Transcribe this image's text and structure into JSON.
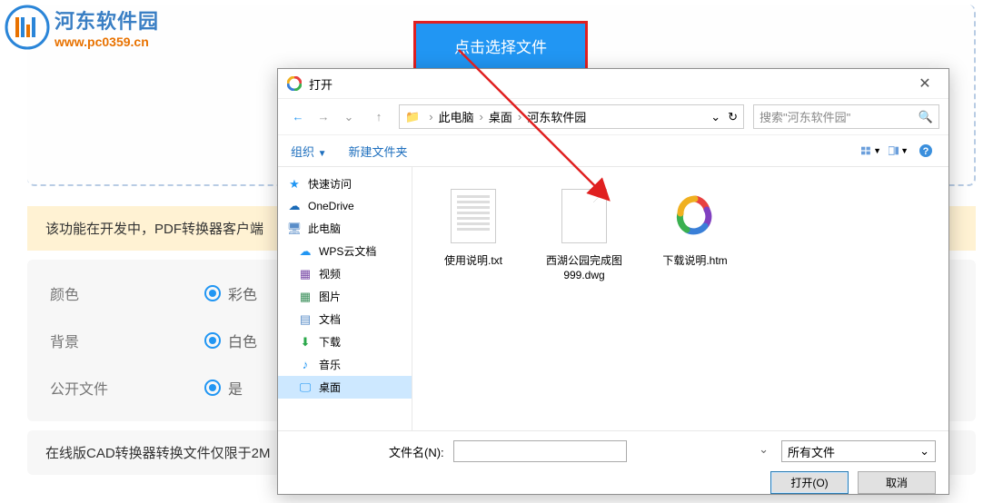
{
  "logo": {
    "title": "河东软件园",
    "url": "www.pc0359.cn"
  },
  "dropzone": {
    "select_button": "点击选择文件"
  },
  "banner": "该功能在开发中，PDF转换器客户端",
  "options": {
    "color_label": "颜色",
    "color_value": "彩色",
    "bg_label": "背景",
    "bg_value": "白色",
    "public_label": "公开文件",
    "public_value": "是"
  },
  "footer": "在线版CAD转换器转换文件仅限于2M",
  "dialog": {
    "title": "打开",
    "breadcrumb": [
      "此电脑",
      "桌面",
      "河东软件园"
    ],
    "search_placeholder": "搜索\"河东软件园\"",
    "toolbar": {
      "organize": "组织",
      "new_folder": "新建文件夹"
    },
    "sidebar": {
      "quick": "快速访问",
      "onedrive": "OneDrive",
      "thispc": "此电脑",
      "wps": "WPS云文档",
      "video": "视频",
      "pictures": "图片",
      "documents": "文档",
      "downloads": "下载",
      "music": "音乐",
      "desktop": "桌面"
    },
    "files": [
      {
        "name": "使用说明.txt",
        "type": "txt"
      },
      {
        "name": "西湖公园完成图999.dwg",
        "type": "dwg"
      },
      {
        "name": "下载说明.htm",
        "type": "htm"
      }
    ],
    "filename_label": "文件名(N):",
    "filter": "所有文件",
    "open_btn": "打开(O)",
    "cancel_btn": "取消"
  }
}
